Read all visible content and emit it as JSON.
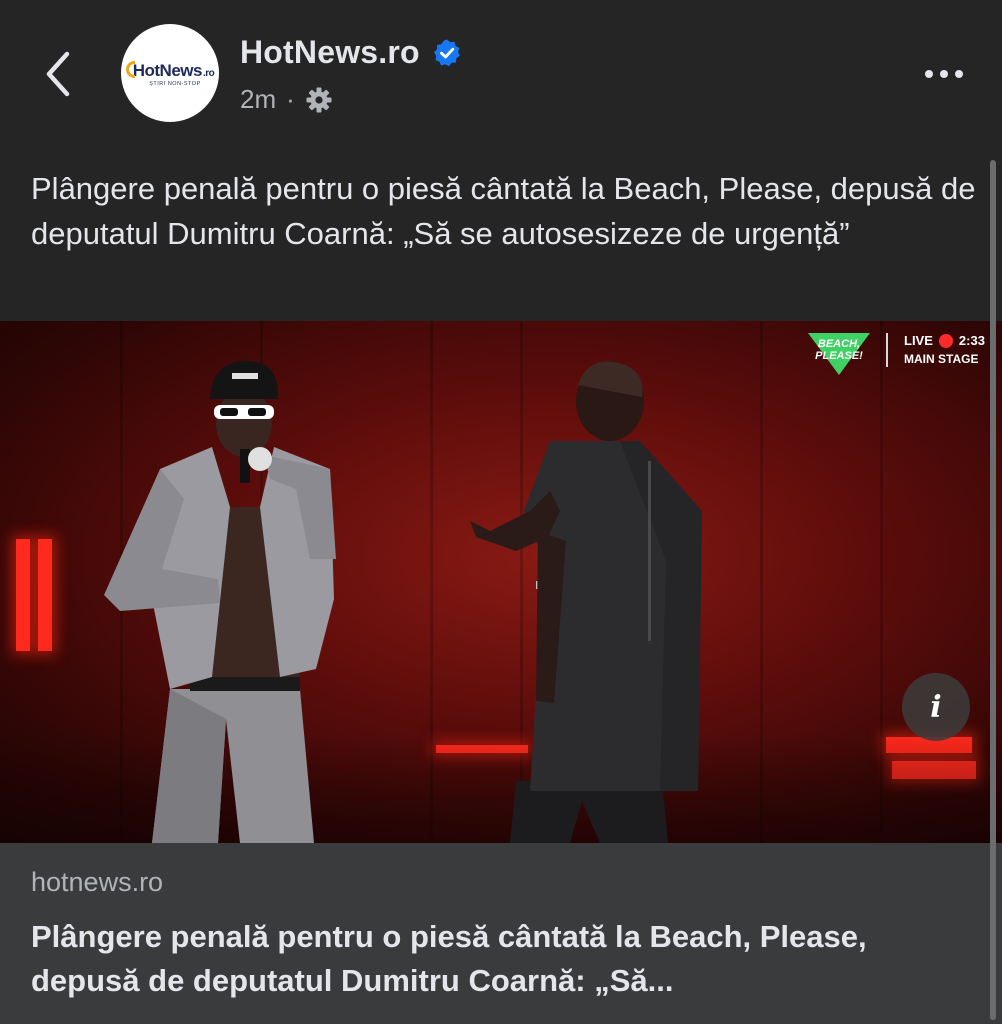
{
  "header": {
    "back_icon": "chevron-left-icon",
    "page_name": "HotNews.ro",
    "verified_icon": "verified-badge-icon",
    "timestamp": "2m",
    "separator": "·",
    "audience_icon": "gear-icon",
    "more_icon": "more-horizontal-icon",
    "avatar": {
      "logo_text": "HotNews",
      "logo_suffix": ".ro",
      "logo_tagline": "ȘTIRI NON-STOP"
    }
  },
  "post": {
    "text": "Plângere penală pentru o piesă cântată la Beach, Please, depusă de deputatul Dumitru Coarnă: „Să se autosesizeze de urgență”"
  },
  "media": {
    "overlay_logo_text": "BEACH, PLEASE!",
    "live_label": "LIVE",
    "live_time": "2:33",
    "stage_label": "MAIN STAGE",
    "info_icon": "info-icon",
    "info_glyph": "i"
  },
  "link_preview": {
    "domain": "hotnews.ro",
    "title": "Plângere penală pentru o piesă cântată la Beach, Please, depusă de deputatul Dumitru Coarnă: „Să..."
  },
  "colors": {
    "background": "#252526",
    "link_preview_bg": "#3a3b3c",
    "verified": "#1877f2",
    "text_primary": "#e4e6eb",
    "text_secondary": "#b0b3b8",
    "stage_red": "#ff2a1e"
  }
}
